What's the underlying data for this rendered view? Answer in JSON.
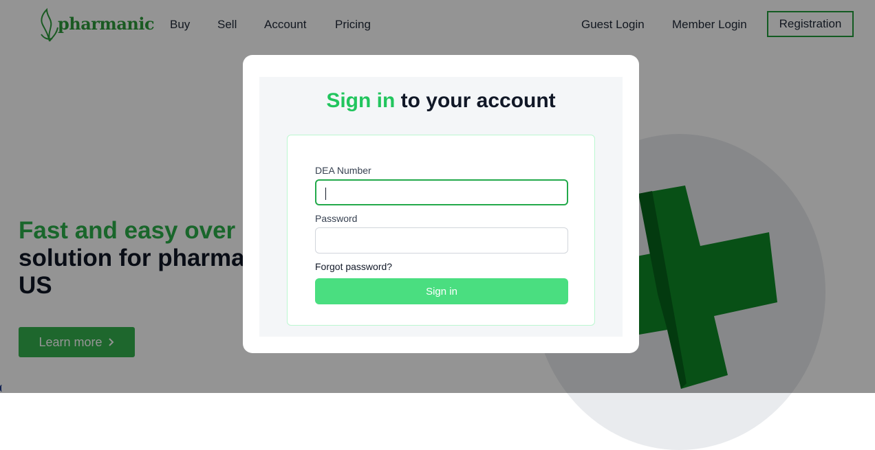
{
  "header": {
    "logo_text": "pharmanic",
    "nav": [
      "Buy",
      "Sell",
      "Account",
      "Pricing"
    ],
    "guest_login": "Guest Login",
    "member_login": "Member Login",
    "registration": "Registration"
  },
  "hero": {
    "title_accent": "Fast and easy over",
    "title_line2": "solution for pharma",
    "title_line3": "US",
    "learn_more": "Learn more"
  },
  "modal": {
    "title_accent": "Sign in",
    "title_rest": " to your account",
    "dea_label": "DEA Number",
    "dea_value": "",
    "password_label": "Password",
    "password_value": "",
    "forgot_password": "Forgot password?",
    "sign_in_button": "Sign in"
  },
  "colors": {
    "brand_green": "#22c55e",
    "button_green": "#4ade80",
    "cross_green": "#0f8a27",
    "overlay": "rgba(0,0,0,0.42)"
  }
}
